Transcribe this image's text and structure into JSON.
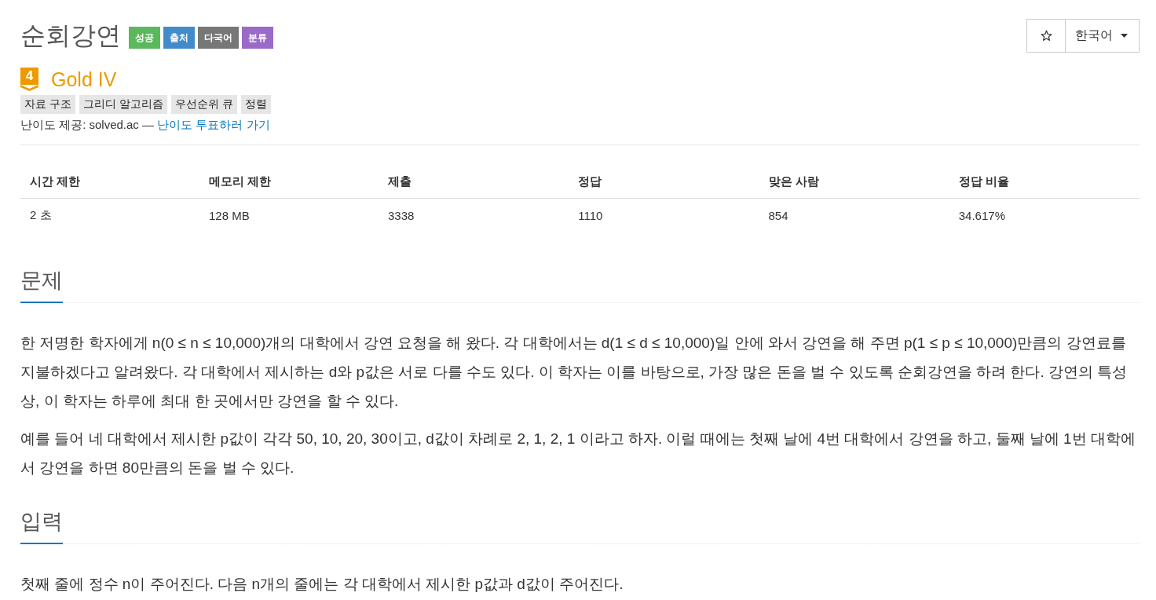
{
  "header": {
    "title": "순회강연",
    "badges": [
      {
        "label": "성공",
        "color": "#5cb85c"
      },
      {
        "label": "출처",
        "color": "#428bca"
      },
      {
        "label": "다국어",
        "color": "#777777"
      },
      {
        "label": "분류",
        "color": "#9b69c7"
      }
    ],
    "favorite": {
      "starred": false
    },
    "language": {
      "label": "한국어"
    }
  },
  "tier": {
    "badge_text": "4",
    "name": "Gold IV",
    "tags": [
      "자료 구조",
      "그리디 알고리즘",
      "우선순위 큐",
      "정렬"
    ],
    "credit": "난이도 제공: solved.ac — ",
    "vote_link": "난이도 투표하러 가기"
  },
  "limits_table": {
    "columns": [
      "시간 제한",
      "메모리 제한",
      "제출",
      "정답",
      "맞은 사람",
      "정답 비율"
    ],
    "rows": [
      [
        "2 초",
        "128 MB",
        "3338",
        "1110",
        "854",
        "34.617%"
      ]
    ]
  },
  "sections": [
    {
      "heading": "문제",
      "paragraphs": [
        "한 저명한 학자에게 n(0 ≤ n ≤ 10,000)개의 대학에서 강연 요청을 해 왔다. 각 대학에서는 d(1 ≤ d ≤ 10,000)일 안에 와서 강연을 해 주면 p(1 ≤ p ≤ 10,000)만큼의 강연료를 지불하겠다고 알려왔다. 각 대학에서 제시하는 d와 p값은 서로 다를 수도 있다. 이 학자는 이를 바탕으로, 가장 많은 돈을 벌 수 있도록 순회강연을 하려 한다. 강연의 특성상, 이 학자는 하루에 최대 한 곳에서만 강연을 할 수 있다.",
        "예를 들어 네 대학에서 제시한 p값이 각각 50, 10, 20, 30이고, d값이 차례로 2, 1, 2, 1 이라고 하자. 이럴 때에는 첫째 날에 4번 대학에서 강연을 하고, 둘째 날에 1번 대학에서 강연을 하면 80만큼의 돈을 벌 수 있다."
      ]
    },
    {
      "heading": "입력",
      "paragraphs": [
        "첫째 줄에 정수 n이 주어진다. 다음 n개의 줄에는 각 대학에서 제시한 p값과 d값이 주어진다."
      ]
    }
  ]
}
